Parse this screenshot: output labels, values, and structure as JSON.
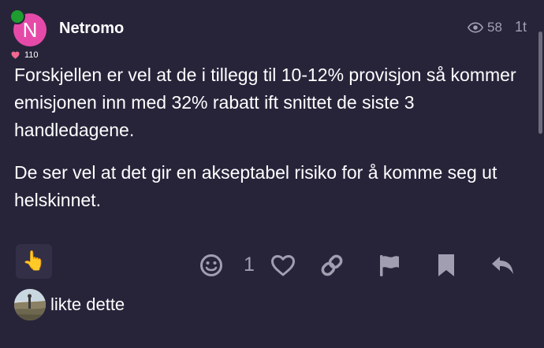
{
  "post": {
    "author": "Netromo",
    "avatar_letter": "N",
    "reaction_count": "110",
    "views": "58",
    "age": "1t",
    "paragraphs": [
      "Forskjellen er vel at de i tillegg til 10-12% provisjon så kommer emisjonen inn med 32% rabatt ift snittet de siste 3 handledagene.",
      "De ser vel at det gir en akseptabel risiko for å komme seg ut helskinnet."
    ]
  },
  "actions": {
    "react_emoji": "👆",
    "like_count": "1"
  },
  "liked_by": {
    "text": "likte dette"
  },
  "colors": {
    "background": "#27243a",
    "avatar": "#e64aa8",
    "online": "#1e9c30",
    "icon": "#a09eb0",
    "heart": "#f2698f"
  }
}
